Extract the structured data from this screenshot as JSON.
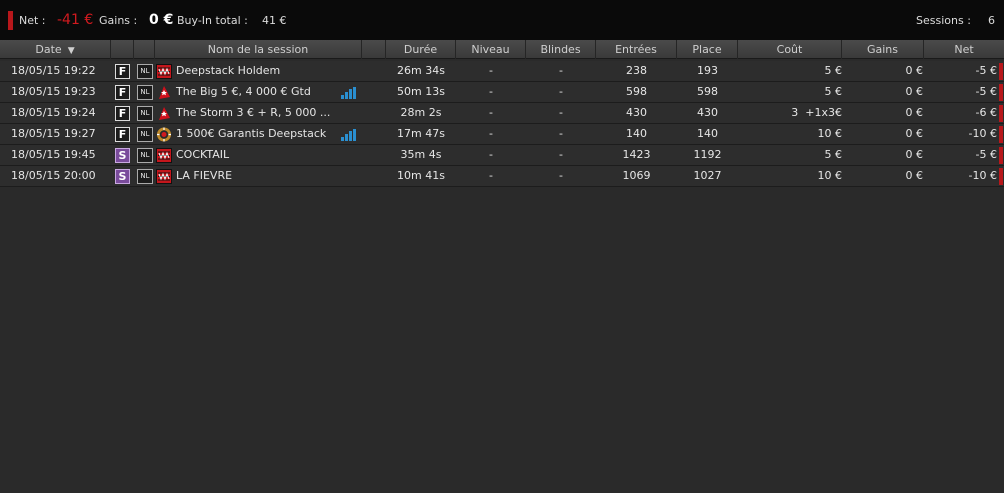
{
  "summary": {
    "net_label": "Net :",
    "net_value": "-41 €",
    "gains_label": "Gains :",
    "gains_value": "0 €",
    "buyin_label": "Buy-In total :",
    "buyin_value": "41 €",
    "sessions_label": "Sessions :",
    "sessions_value": "6"
  },
  "columns": {
    "date": "Date",
    "name": "Nom de la session",
    "duration": "Durée",
    "level": "Niveau",
    "blinds": "Blindes",
    "entries": "Entrées",
    "place": "Place",
    "cost": "Coût",
    "gains": "Gains",
    "net": "Net"
  },
  "sort_indicator": "▼",
  "colors": {
    "negative": "#d21a1f",
    "marker": "#b8171b",
    "badge_s": "#7a4b9c",
    "bars": "#2a8fd0"
  },
  "rows": [
    {
      "date": "18/05/15 19:22",
      "type": "F",
      "limit": "NL",
      "room_icon": "winamax-icon",
      "name": "Deepstack Holdem",
      "bars": false,
      "duration": "26m 34s",
      "level": "-",
      "blinds": "-",
      "entries": "238",
      "place": "193",
      "cost": "5 €",
      "gains": "0 €",
      "net": "-5 €"
    },
    {
      "date": "18/05/15 19:23",
      "type": "F",
      "limit": "NL",
      "room_icon": "pokerstars-icon",
      "name": "The Big 5 €, 4 000 € Gtd",
      "bars": true,
      "duration": "50m 13s",
      "level": "-",
      "blinds": "-",
      "entries": "598",
      "place": "598",
      "cost": "5 €",
      "gains": "0 €",
      "net": "-5 €"
    },
    {
      "date": "18/05/15 19:24",
      "type": "F",
      "limit": "NL",
      "room_icon": "pokerstars-icon",
      "name": "The Storm 3 € + R, 5 000 ...",
      "bars": false,
      "duration": "28m 2s",
      "level": "-",
      "blinds": "-",
      "entries": "430",
      "place": "430",
      "cost": "3  +1x3€",
      "gains": "0 €",
      "net": "-6 €"
    },
    {
      "date": "18/05/15 19:27",
      "type": "F",
      "limit": "NL",
      "room_icon": "poker-chip-icon",
      "name": "1 500€ Garantis Deepstack",
      "bars": true,
      "duration": "17m 47s",
      "level": "-",
      "blinds": "-",
      "entries": "140",
      "place": "140",
      "cost": "10 €",
      "gains": "0 €",
      "net": "-10 €"
    },
    {
      "date": "18/05/15 19:45",
      "type": "S",
      "limit": "NL",
      "room_icon": "winamax-icon",
      "name": "COCKTAIL",
      "bars": false,
      "duration": "35m 4s",
      "level": "-",
      "blinds": "-",
      "entries": "1423",
      "place": "1192",
      "cost": "5 €",
      "gains": "0 €",
      "net": "-5 €"
    },
    {
      "date": "18/05/15 20:00",
      "type": "S",
      "limit": "NL",
      "room_icon": "winamax-icon",
      "name": "LA FIEVRE",
      "bars": false,
      "duration": "10m 41s",
      "level": "-",
      "blinds": "-",
      "entries": "1069",
      "place": "1027",
      "cost": "10 €",
      "gains": "0 €",
      "net": "-10 €"
    }
  ]
}
